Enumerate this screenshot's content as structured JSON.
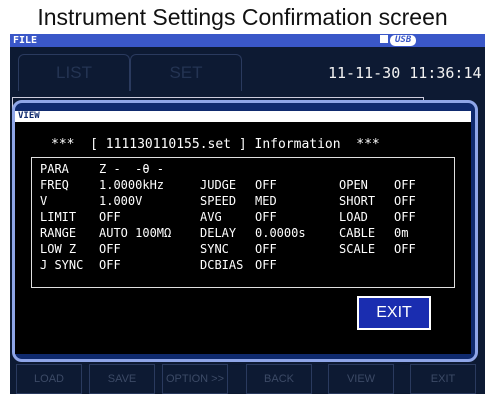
{
  "caption": "Instrument Settings Confirmation screen",
  "header": {
    "file_label": "FILE",
    "usb_label": "USB"
  },
  "tabs": [
    {
      "label": "LIST"
    },
    {
      "label": "SET"
    }
  ],
  "datetime": "11-11-30 11:36:14",
  "dialog": {
    "title_bar": "VIEW",
    "info_title": "***  [ 111130110155.set ] Information  ***",
    "rows": [
      [
        {
          "label": "PARA",
          "value": "Z -  -θ -"
        }
      ],
      [
        {
          "label": "FREQ",
          "value": "1.0000kHz"
        },
        {
          "label": "JUDGE",
          "value": "OFF"
        },
        {
          "label": "OPEN",
          "value": "OFF"
        }
      ],
      [
        {
          "label": "V",
          "value": "1.000V"
        },
        {
          "label": "SPEED",
          "value": "MED"
        },
        {
          "label": "SHORT",
          "value": "OFF"
        }
      ],
      [
        {
          "label": "LIMIT",
          "value": "OFF"
        },
        {
          "label": "AVG",
          "value": "OFF"
        },
        {
          "label": "LOAD",
          "value": "OFF"
        }
      ],
      [
        {
          "label": "RANGE",
          "value": "AUTO 100MΩ"
        },
        {
          "label": "DELAY",
          "value": "0.0000s"
        },
        {
          "label": "CABLE",
          "value": "0m"
        }
      ],
      [
        {
          "label": "LOW Z",
          "value": "OFF"
        },
        {
          "label": "SYNC",
          "value": "OFF"
        },
        {
          "label": "SCALE",
          "value": "OFF"
        }
      ],
      [
        {
          "label": "J SYNC",
          "value": "OFF"
        },
        {
          "label": "DCBIAS",
          "value": "OFF"
        }
      ]
    ],
    "exit_label": "EXIT"
  },
  "bottom_buttons": [
    "LOAD",
    "SAVE",
    "OPTION >>",
    "BACK",
    "VIEW",
    "EXIT"
  ],
  "colors": {
    "file_bar": "#3a57c8",
    "dialog_frame": "#8fa6e8",
    "dialog_bg": "#0f2a6e",
    "body_bg": "#000000",
    "exit_button": "#1a2db0"
  }
}
